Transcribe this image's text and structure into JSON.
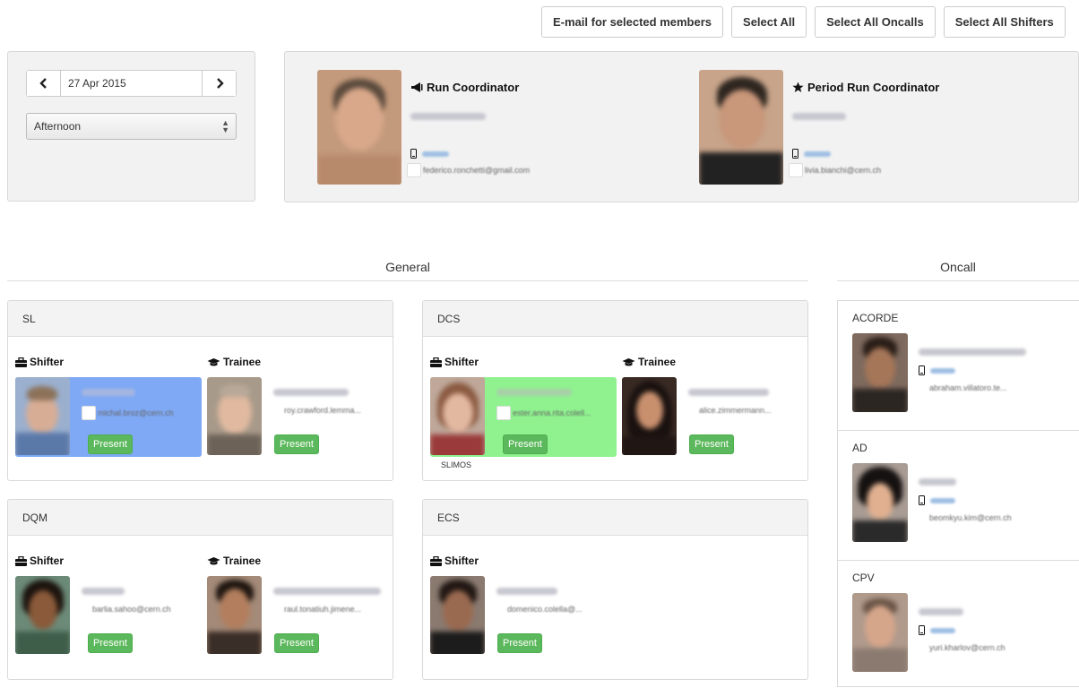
{
  "toolbar": {
    "email_selected": "E-mail for selected members",
    "select_all": "Select All",
    "select_all_oncalls": "Select All Oncalls",
    "select_all_shifters": "Select All Shifters"
  },
  "date_picker": {
    "date": "27 Apr 2015",
    "shift": "Afternoon"
  },
  "coordinators": [
    {
      "role": "Run Coordinator",
      "email": "federico.ronchetti@gmail.com"
    },
    {
      "role": "Period Run Coordinator",
      "email": "livia.bianchi@cern.ch"
    }
  ],
  "sections": {
    "general": "General",
    "oncall": "Oncall"
  },
  "cards": {
    "sl": {
      "title": "SL",
      "shifter_label": "Shifter",
      "trainee_label": "Trainee",
      "shifter_email": "michal.broz@cern.ch",
      "trainee_email": "roy.crawford.lemma...",
      "present": "Present"
    },
    "dcs": {
      "title": "DCS",
      "shifter_label": "Shifter",
      "trainee_label": "Trainee",
      "shifter_email": "ester.anna.rita.colell...",
      "trainee_email": "alice.zimmermann...",
      "shifter_sub": "SLIMOS",
      "present": "Present"
    },
    "dqm": {
      "title": "DQM",
      "shifter_label": "Shifter",
      "trainee_label": "Trainee",
      "shifter_email": "barlia.sahoo@cern.ch",
      "trainee_email": "raul.tonatiuh.jimene...",
      "present": "Present"
    },
    "ecs": {
      "title": "ECS",
      "shifter_label": "Shifter",
      "shifter_email": "domenico.colella@...",
      "present": "Present"
    }
  },
  "oncall": [
    {
      "label": "ACORDE",
      "email": "abraham.villatoro.te..."
    },
    {
      "label": "AD",
      "email": "beomkyu.kim@cern.ch"
    },
    {
      "label": "CPV",
      "email": "yuri.kharlov@cern.ch"
    }
  ],
  "colors": {
    "present_green": "#5cb85c",
    "selected_blue": "#7fa9f5",
    "selected_green": "#8ff28f",
    "link_blue": "#4a90d9"
  }
}
